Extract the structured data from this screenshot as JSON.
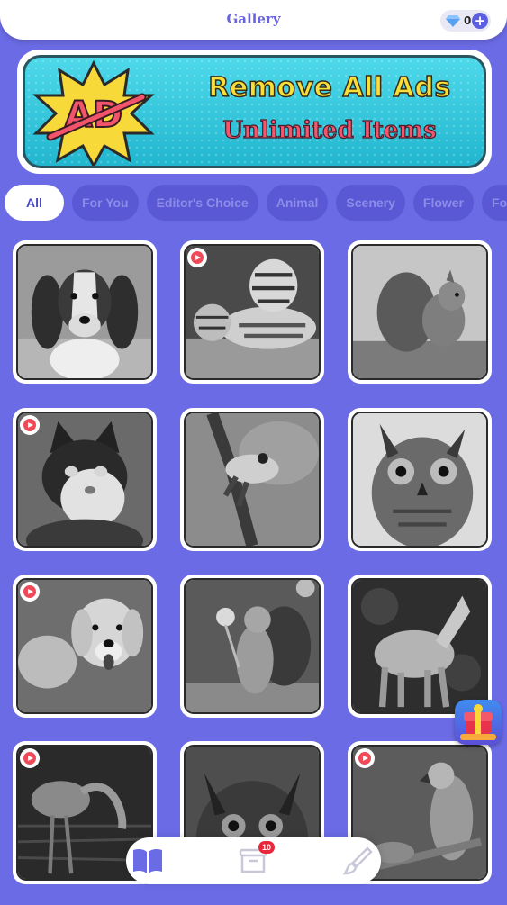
{
  "header": {
    "title": "Gallery",
    "gem_count": "0",
    "gem_icon": "diamond-icon",
    "add_icon": "plus-icon"
  },
  "banner": {
    "badge_text": "AD",
    "line1": "Remove All Ads",
    "line2": "Unlimited Items"
  },
  "tabs": [
    {
      "label": "All",
      "active": true
    },
    {
      "label": "For You"
    },
    {
      "label": "Editor's Choice"
    },
    {
      "label": "Animal"
    },
    {
      "label": "Scenery"
    },
    {
      "label": "Flower"
    },
    {
      "label": "Food"
    }
  ],
  "gallery": [
    {
      "subject": "spaniel dog",
      "video": false
    },
    {
      "subject": "tigers",
      "video": true
    },
    {
      "subject": "squirrel",
      "video": false
    },
    {
      "subject": "cat",
      "video": true
    },
    {
      "subject": "frog on branch",
      "video": false
    },
    {
      "subject": "owl",
      "video": false
    },
    {
      "subject": "golden retriever",
      "video": true
    },
    {
      "subject": "squirrel with flower",
      "video": false
    },
    {
      "subject": "howling wolf",
      "video": false
    },
    {
      "subject": "flamingo",
      "video": true
    },
    {
      "subject": "owl",
      "video": false
    },
    {
      "subject": "parrot",
      "video": true
    }
  ],
  "bottom_nav": {
    "items": [
      {
        "icon": "book-icon",
        "active": true
      },
      {
        "icon": "inbox-icon",
        "badge": "10"
      },
      {
        "icon": "brush-icon"
      }
    ]
  },
  "colors": {
    "background": "#6b6be6",
    "accent": "#5b5fe0",
    "badge": "#e8283a"
  }
}
